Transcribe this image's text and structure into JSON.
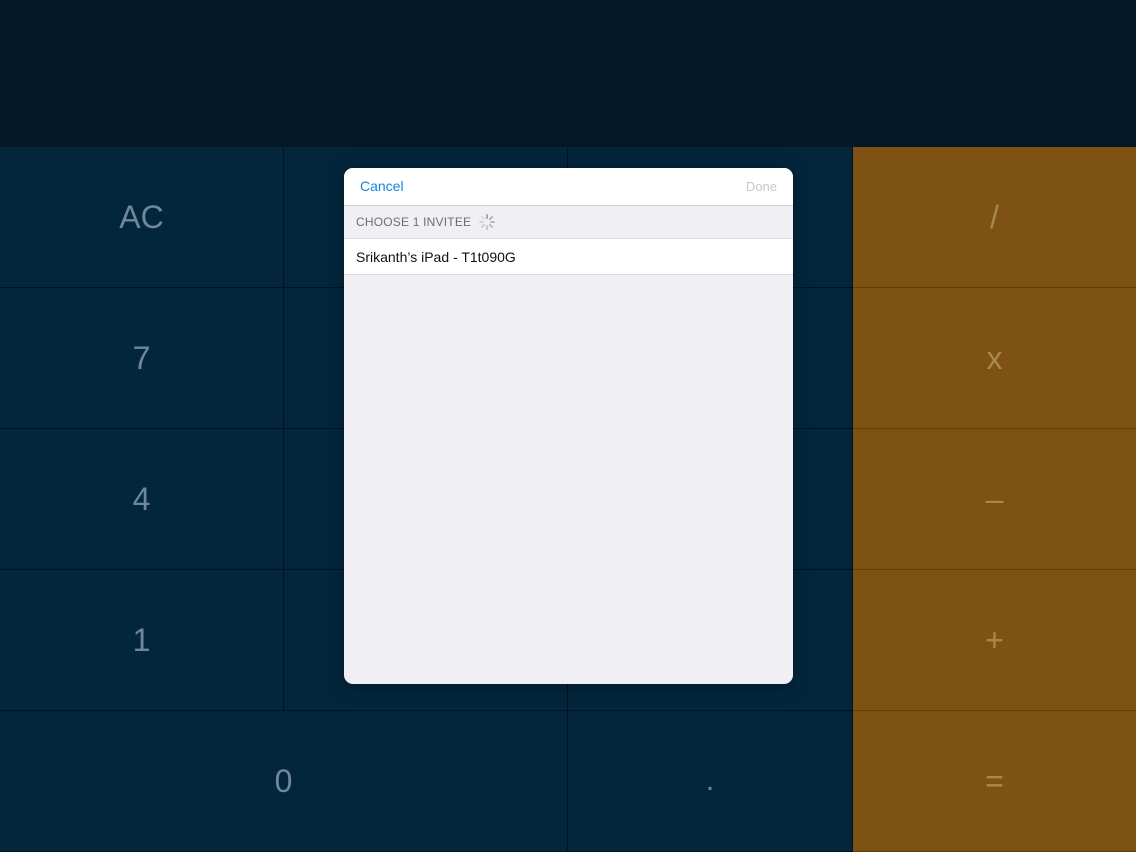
{
  "keypad": {
    "ac": "AC",
    "seven": "7",
    "four": "4",
    "one": "1",
    "zero": "0",
    "dot": ".",
    "divide": "/",
    "multiply": "x",
    "minus": "–",
    "plus": "+",
    "equals": "="
  },
  "modal": {
    "cancel_label": "Cancel",
    "done_label": "Done",
    "section_header": "CHOOSE 1 INVITEE",
    "invitees": [
      {
        "name": "Srikanth’s iPad - T1t090G"
      }
    ]
  },
  "colors": {
    "number_key_bg": "#04263d",
    "operator_key_bg": "#7e5212",
    "accent_link": "#1a82e0"
  },
  "icons": {
    "loading": "activity-spinner-icon"
  }
}
